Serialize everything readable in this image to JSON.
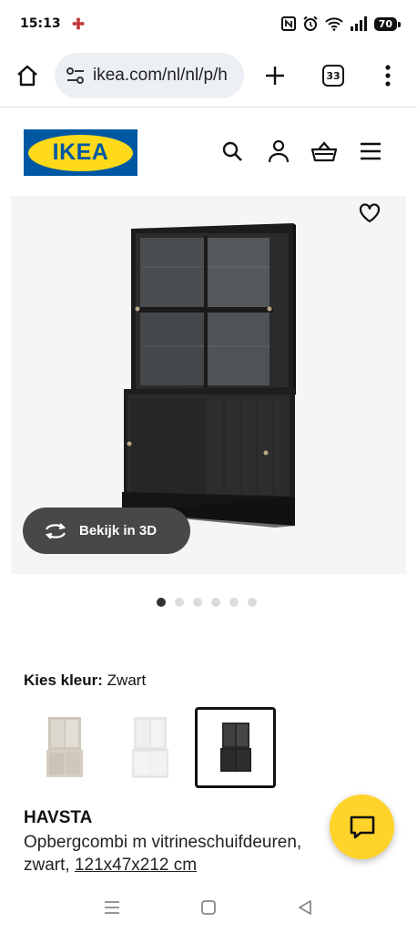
{
  "status_bar": {
    "time": "15:13",
    "battery": "70"
  },
  "browser": {
    "url": "ikea.com/nl/nl/p/h",
    "tab_count": "33"
  },
  "header": {
    "logo_text": "IKEA",
    "brand_colors": {
      "blue": "#0058a3",
      "yellow": "#ffda1a"
    },
    "icons": [
      "search-icon",
      "account-icon",
      "basket-icon",
      "menu-icon"
    ]
  },
  "gallery": {
    "view_3d_label": "Bekijk in 3D",
    "image_count": 6,
    "active_index": 0
  },
  "color_picker": {
    "label": "Kies kleur:",
    "selected_value": "Zwart",
    "swatches": [
      {
        "name": "grey-beige",
        "color": "#d8d2c6",
        "selected": false
      },
      {
        "name": "white",
        "color": "#f4f4f2",
        "selected": false
      },
      {
        "name": "black",
        "color": "#2a2a2a",
        "selected": true
      }
    ]
  },
  "product": {
    "name": "HAVSTA",
    "description": "Opbergcombi m vitrineschuifdeuren,",
    "description_line2": "zwart, ",
    "dimensions": "121x47x212 cm"
  },
  "colors": {
    "chat_button": "#ffd32a",
    "view3d_button": "#484848"
  }
}
